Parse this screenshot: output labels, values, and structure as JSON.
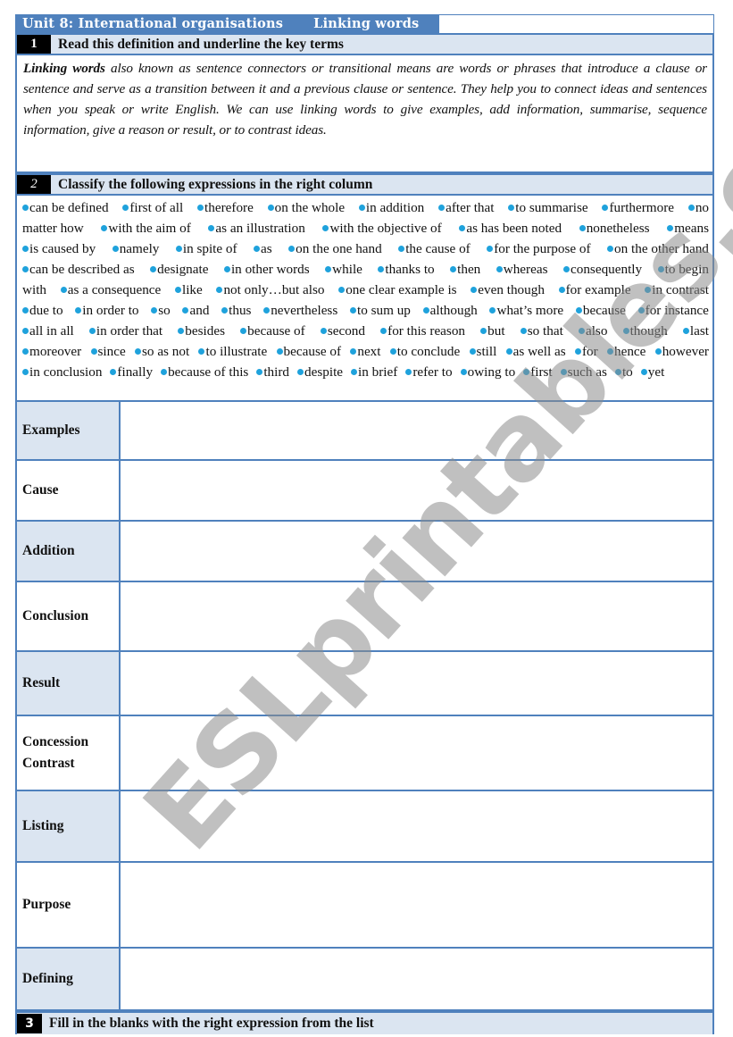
{
  "header": {
    "unit_title": "Unit 8: International organisations",
    "topic": "Linking words"
  },
  "section1": {
    "number": "1",
    "instruction": "Read this definition and underline the key terms",
    "definition_term": "Linking words",
    "definition_text": " also known as sentence connectors or transitional means are words or phrases that introduce a clause or sentence and serve as a transition between it and a previous clause or sentence. They help you to connect ideas and sentences when you speak or write English. We can use linking words to give examples, add information, summarise, sequence information, give a reason or result, or to contrast ideas."
  },
  "section2": {
    "number": "2",
    "instruction": "Classify the following expressions in the right column",
    "word_lines": [
      [
        "can be defined",
        "first of all",
        "therefore",
        "on the whole",
        "in addition",
        "after that",
        "to summarise",
        "furthermore",
        "no"
      ],
      [
        "matter how",
        "with the aim of",
        "as an illustration",
        "with the objective of",
        "as has been noted",
        "nonetheless",
        "means"
      ],
      [
        "is caused by",
        "namely",
        "in spite of",
        "as",
        "on the one hand",
        "the cause of",
        "for the purpose of",
        "on the other hand"
      ],
      [
        "can be described as",
        "designate",
        "in other words",
        "while",
        "thanks to",
        "then",
        "whereas",
        "consequently",
        "to begin"
      ],
      [
        "with",
        "as a consequence",
        "like",
        "not only…but also",
        "one clear example is",
        "even though",
        "for example",
        "in contrast"
      ],
      [
        "due to",
        "in order to",
        "so",
        "and",
        "thus",
        "nevertheless",
        "to sum up",
        "although",
        "what’s more",
        "because",
        "for instance"
      ],
      [
        "all in all",
        "in order that",
        "besides",
        "because of",
        "second",
        "for this reason",
        "but",
        "so that",
        "also",
        "though",
        "last"
      ],
      [
        "moreover",
        "since",
        "so as not",
        "to illustrate",
        "because of",
        "next",
        "to conclude",
        "still",
        "as well as",
        "for",
        "hence",
        "however"
      ],
      [
        "in conclusion",
        "finally",
        "because of this",
        "third",
        "despite",
        "in brief",
        "refer to",
        "owing to",
        "first",
        "such as",
        "to",
        "yet"
      ]
    ],
    "continuation_words": [
      "1:0",
      "4:0"
    ]
  },
  "table": {
    "categories": [
      {
        "label": "Examples",
        "answer": ""
      },
      {
        "label": "Cause",
        "answer": ""
      },
      {
        "label": "Addition",
        "answer": ""
      },
      {
        "label": "Conclusion",
        "answer": ""
      },
      {
        "label": "Result",
        "answer": ""
      },
      {
        "label": "Concession Contrast",
        "answer": ""
      },
      {
        "label": "Listing",
        "answer": ""
      },
      {
        "label": "Purpose",
        "answer": ""
      },
      {
        "label": "Defining",
        "answer": ""
      }
    ]
  },
  "section3": {
    "number": "3",
    "instruction": "Fill in the blanks with the right expression from the list"
  },
  "watermark": "ESLprintables.com",
  "colors": {
    "accent_blue": "#4f81bd",
    "header_fill": "#dbe5f1",
    "bullet": "#1fa2dc",
    "number_box": "#000000"
  }
}
